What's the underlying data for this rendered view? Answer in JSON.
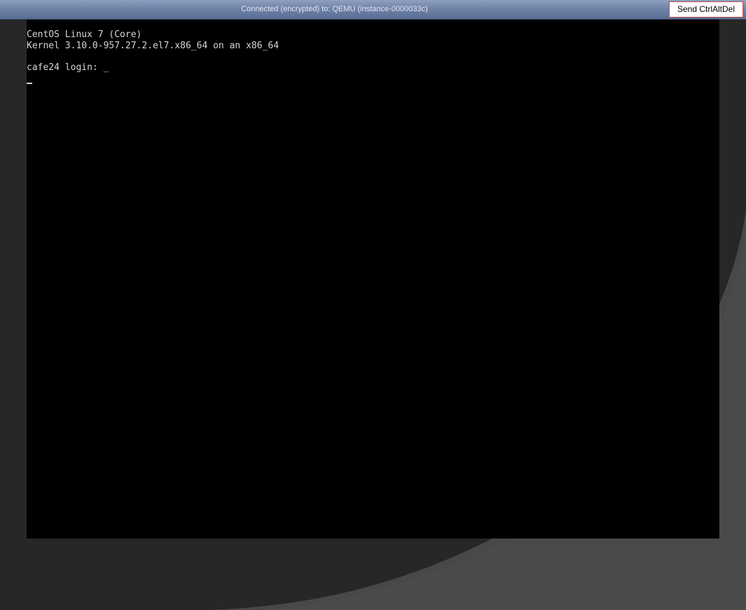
{
  "window": {
    "title": "Connected (encrypted) to: QEMU (instance-0000033c)"
  },
  "toolbar": {
    "send_ctrl_alt_del_label": "Send CtrlAltDel"
  },
  "console": {
    "lines": [
      "CentOS Linux 7 (Core)",
      "Kernel 3.10.0-957.27.2.el7.x86_64 on an x86_64",
      "",
      "cafe24 login: _"
    ]
  },
  "colors": {
    "titlebar": "#6f82a8",
    "button_border": "#c8544a",
    "console_bg": "#000000",
    "console_text": "#d6d6d6",
    "page_bg": "#262626"
  }
}
